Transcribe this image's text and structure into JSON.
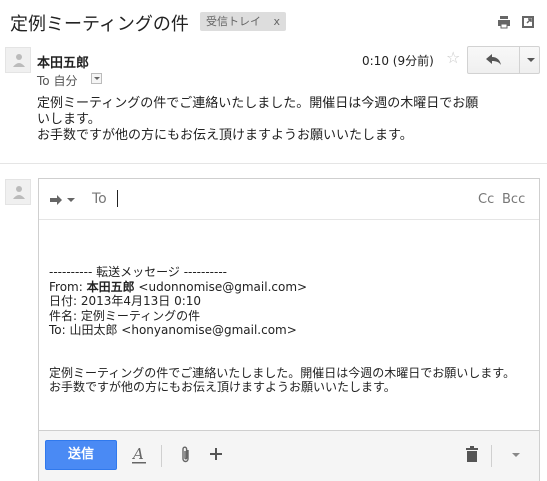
{
  "header": {
    "subject": "定例ミーティングの件",
    "label": "受信トレイ",
    "label_remove": "x",
    "icons": [
      "print-icon",
      "new-window-icon"
    ]
  },
  "message": {
    "sender": "本田五郎",
    "recipient": "To 自分",
    "timestamp": "0:10 (9分前)",
    "star": "☆",
    "body_lines": [
      "定例ミーティングの件でご連絡いたしました。開催日は今週の木曜日でお願",
      "いします。",
      "お手数ですが他の方にもお伝え頂けますようお願いいたします。"
    ]
  },
  "compose": {
    "to_label": "To",
    "cc": "Cc",
    "bcc": "Bcc",
    "fwd_header": "---------- 転送メッセージ ----------",
    "from_prefix": "From: ",
    "from_name": "本田五郎",
    "from_email": " <udonnomise@gmail.com>",
    "date": "日付: 2013年4月13日 0:10",
    "subject_line": "件名: 定例ミーティングの件",
    "to_line": "To: 山田太郎 <honyanomise@gmail.com>",
    "body_lines": [
      "定例ミーティングの件でご連絡いたしました。開催日は今週の木曜日でお願いします。",
      "お手数ですが他の方にもお伝え頂けますようお願いいたします。"
    ]
  },
  "toolbar": {
    "send": "送信"
  }
}
